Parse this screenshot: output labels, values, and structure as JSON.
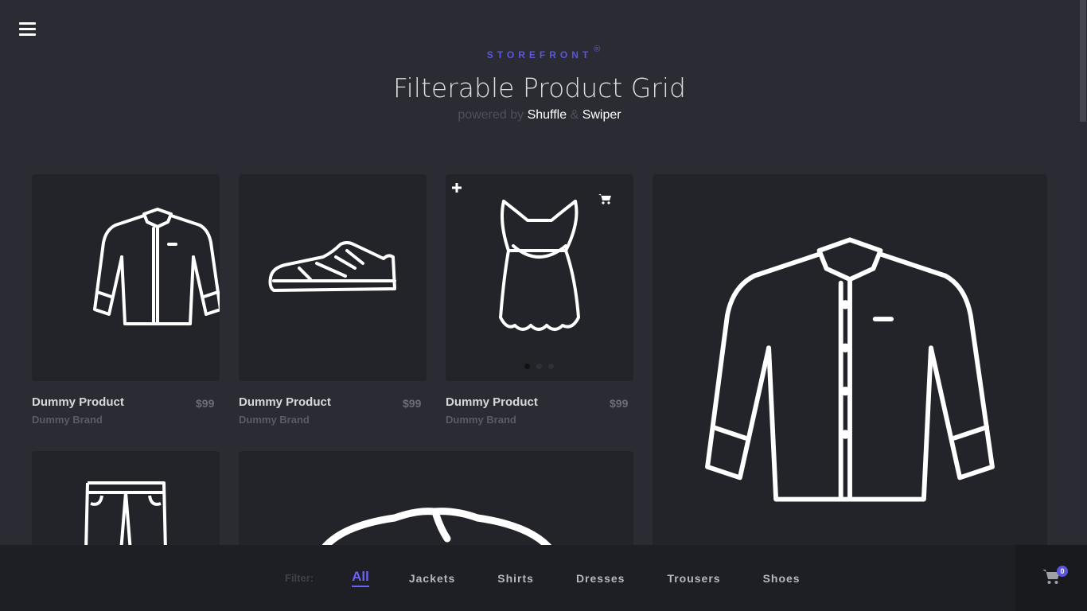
{
  "header": {
    "brand": "STOREFRONT",
    "brand_mark": "®",
    "title": "Filterable Product Grid",
    "powered_by": "powered by",
    "lib1": "Shuffle",
    "amp": "&",
    "lib2": "Swiper"
  },
  "products": [
    {
      "name": "Dummy Product",
      "brand": "Dummy Brand",
      "price": "$99",
      "icon": "shirt-icon"
    },
    {
      "name": "Dummy Product",
      "brand": "Dummy Brand",
      "price": "$99",
      "icon": "sneaker-icon"
    },
    {
      "name": "Dummy Product",
      "brand": "Dummy Brand",
      "price": "$99",
      "icon": "dress-icon"
    }
  ],
  "featured": {
    "icon": "shirt-icon"
  },
  "footer": {
    "filter_label": "Filter:",
    "filters": [
      "All",
      "Jackets",
      "Shirts",
      "Dresses",
      "Trousers",
      "Shoes"
    ],
    "active_filter": "All",
    "cart_count": "0"
  },
  "colors": {
    "accent": "#5b55e0",
    "background": "#2b2c33",
    "card": "#23242a"
  }
}
